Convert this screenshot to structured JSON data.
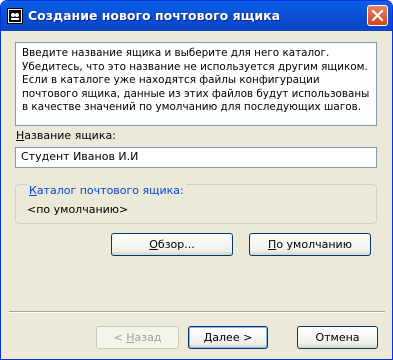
{
  "window": {
    "title": "Создание нового почтового ящика"
  },
  "description": "Введите название ящика и выберите для него каталог. Убедитесь, что это название не используется другим ящиком. Если в каталоге уже находятся файлы конфигурации почтового ящика, данные из этих файлов будут использованы в качестве значений по умолчанию для последующих шагов.",
  "mailbox_name": {
    "label_underlined": "Н",
    "label_rest": "азвание ящика:",
    "value": "Студент Иванов И.И"
  },
  "catalog": {
    "label_underlined": "К",
    "label_rest": "аталог почтового ящика:",
    "value": "<по умолчанию>"
  },
  "buttons": {
    "browse_underlined": "О",
    "browse_rest": "бзор...",
    "default_underlined": "П",
    "default_rest": "о умолчанию",
    "back_prefix": "< ",
    "back_underlined": "Н",
    "back_rest": "азад",
    "next_underlined": "Д",
    "next_rest": "алее >",
    "cancel": "Отмена"
  },
  "icons": {
    "app": "mail-app-icon",
    "close": "close-icon"
  },
  "colors": {
    "titlebar": "#0a5fe8",
    "close_button": "#d0451f",
    "group_legend": "#0046d5",
    "dialog_bg": "#ece9d8"
  }
}
